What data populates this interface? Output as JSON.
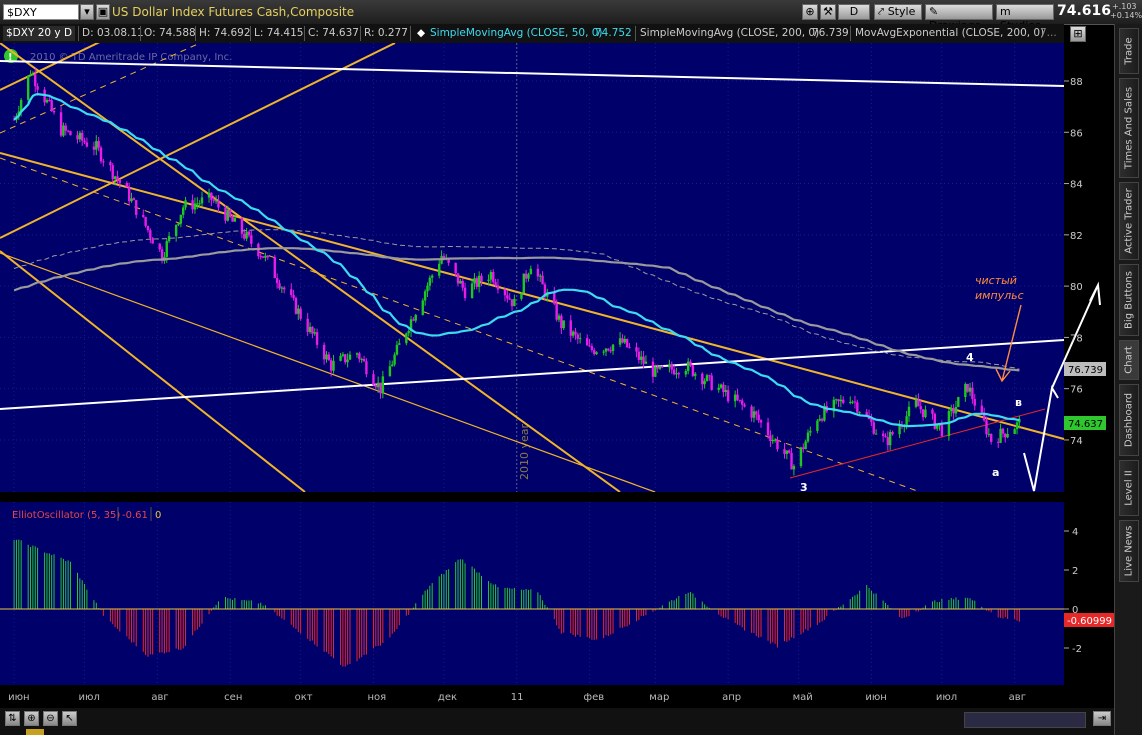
{
  "toolbar": {
    "symbol": "$DXY",
    "description": "US Dollar Index Futures Cash,Composite",
    "period_button": "D",
    "style_label": "Style",
    "drawings_label": "Drawings",
    "studies_label": "Studies",
    "last_price": "74.616",
    "change_abs": "+.103",
    "change_pct": "+0.14%"
  },
  "infobar": {
    "title": "$DXY 20 y D",
    "date": "D: 03.08.11",
    "open": "O: 74.588",
    "high": "H: 74.692",
    "low": "L: 74.415",
    "close": "C: 74.637",
    "range": "R: 0.277",
    "sma50_label": "SimpleMovingAvg (CLOSE, 50, 0)",
    "sma50_value": "74.752",
    "sma200_label": "SimpleMovingAvg (CLOSE, 200, 0)",
    "sma200_value": "76.739",
    "ema200_label": "MovAvgExponential (CLOSE, 200, 0)",
    "ema200_value": "7..."
  },
  "watermark": "2010 © TD Ameritrade IP Company, Inc.",
  "year_marker": "2010 year",
  "annotations": {
    "impulse": "чистый\nимпульс",
    "wave4": "4",
    "wave3": "3",
    "wave_a": "а",
    "wave_b": "в"
  },
  "price_axis": {
    "ticks": [
      "88",
      "86",
      "84",
      "82",
      "80",
      "78",
      "76",
      "74"
    ],
    "sma200_tag": "76.739",
    "last_tag": "74.637"
  },
  "oscillator": {
    "label": "ElliotOscillator (5, 35)",
    "value": "-0.61",
    "extra": "0",
    "ticks": [
      "4",
      "2",
      "0",
      "-2"
    ],
    "tag": "-0.60999"
  },
  "time_axis": [
    "июн",
    "июл",
    "авг",
    "сен",
    "окт",
    "ноя",
    "дек",
    "11",
    "фев",
    "мар",
    "апр",
    "май",
    "июн",
    "июл",
    "авг"
  ],
  "sidebar_tabs": [
    "Trade",
    "Times And Sales",
    "Active Trader",
    "Big Buttons",
    "Chart",
    "Dashboard",
    "Level II",
    "Live News"
  ],
  "colors": {
    "background": "#00006b",
    "bull_candle": "#1ec81e",
    "bear_candle": "#e61ee6",
    "sma50": "#3cdcf0",
    "sma200": "#9a9a9a",
    "channel": "#f0b428",
    "trend": "#ffffff",
    "osc_pos": "#28c828",
    "osc_neg": "#e62828",
    "annotation": "#ff8c3c"
  },
  "chart_data": [
    {
      "type": "candlestick",
      "title": "$DXY 20 y D",
      "x": [
        "июн",
        "июл",
        "авг",
        "сен",
        "окт",
        "ноя",
        "дек",
        "11",
        "фев",
        "мар",
        "апр",
        "май",
        "июн",
        "июл",
        "авг"
      ],
      "ylim": [
        72,
        89
      ],
      "close_path": [
        [
          "2010-06-01",
          86.5
        ],
        [
          "2010-06-08",
          88.4
        ],
        [
          "2010-06-21",
          86.1
        ],
        [
          "2010-07-06",
          85.4
        ],
        [
          "2010-07-20",
          83.5
        ],
        [
          "2010-08-03",
          81.2
        ],
        [
          "2010-08-12",
          83.1
        ],
        [
          "2010-08-24",
          83.4
        ],
        [
          "2010-09-01",
          82.6
        ],
        [
          "2010-09-15",
          81.2
        ],
        [
          "2010-09-30",
          79.0
        ],
        [
          "2010-10-14",
          76.9
        ],
        [
          "2010-10-25",
          77.4
        ],
        [
          "2010-11-04",
          76.0
        ],
        [
          "2010-11-15",
          78.3
        ],
        [
          "2010-11-30",
          81.2
        ],
        [
          "2010-12-10",
          79.8
        ],
        [
          "2010-12-21",
          80.5
        ],
        [
          "2010-12-31",
          79.3
        ],
        [
          "2011-01-07",
          80.9
        ],
        [
          "2011-01-20",
          78.5
        ],
        [
          "2011-02-01",
          77.5
        ],
        [
          "2011-02-15",
          77.8
        ],
        [
          "2011-03-01",
          76.6
        ],
        [
          "2011-03-14",
          76.9
        ],
        [
          "2011-03-31",
          75.8
        ],
        [
          "2011-04-12",
          75.0
        ],
        [
          "2011-04-29",
          73.0
        ],
        [
          "2011-05-09",
          74.9
        ],
        [
          "2011-05-23",
          75.7
        ],
        [
          "2011-06-07",
          73.9
        ],
        [
          "2011-06-20",
          75.4
        ],
        [
          "2011-07-01",
          74.4
        ],
        [
          "2011-07-12",
          76.1
        ],
        [
          "2011-07-22",
          74.0
        ],
        [
          "2011-08-03",
          74.64
        ]
      ],
      "series": [
        {
          "name": "SimpleMovingAvg (CLOSE, 50, 0)",
          "last": 74.752
        },
        {
          "name": "SimpleMovingAvg (CLOSE, 200, 0)",
          "last": 76.739
        },
        {
          "name": "MovAvgExponential (CLOSE, 200, 0)"
        }
      ],
      "ohlc_last": {
        "open": 74.588,
        "high": 74.692,
        "low": 74.415,
        "close": 74.637
      }
    },
    {
      "type": "bar",
      "title": "ElliotOscillator (5, 35)",
      "ylim": [
        -3,
        4.5
      ],
      "last": -0.60999,
      "profile": [
        [
          "2010-06-01",
          3.6
        ],
        [
          "2010-06-25",
          2.4
        ],
        [
          "2010-07-10",
          -0.5
        ],
        [
          "2010-07-28",
          -2.4
        ],
        [
          "2010-08-12",
          -2.0
        ],
        [
          "2010-08-28",
          0.6
        ],
        [
          "2010-09-14",
          0.3
        ],
        [
          "2010-10-01",
          -1.2
        ],
        [
          "2010-10-20",
          -3.0
        ],
        [
          "2010-11-08",
          -1.5
        ],
        [
          "2010-11-25",
          1.2
        ],
        [
          "2010-12-08",
          2.6
        ],
        [
          "2010-12-24",
          1.1
        ],
        [
          "2011-01-10",
          0.9
        ],
        [
          "2011-01-20",
          -1.2
        ],
        [
          "2011-02-05",
          -1.6
        ],
        [
          "2011-02-25",
          -0.3
        ],
        [
          "2011-03-15",
          0.9
        ],
        [
          "2011-04-01",
          -0.6
        ],
        [
          "2011-04-22",
          -1.9
        ],
        [
          "2011-05-10",
          -0.7
        ],
        [
          "2011-05-30",
          1.2
        ],
        [
          "2011-06-14",
          -0.5
        ],
        [
          "2011-06-28",
          0.4
        ],
        [
          "2011-07-12",
          0.6
        ],
        [
          "2011-07-25",
          -0.4
        ],
        [
          "2011-08-03",
          -0.61
        ]
      ]
    }
  ]
}
